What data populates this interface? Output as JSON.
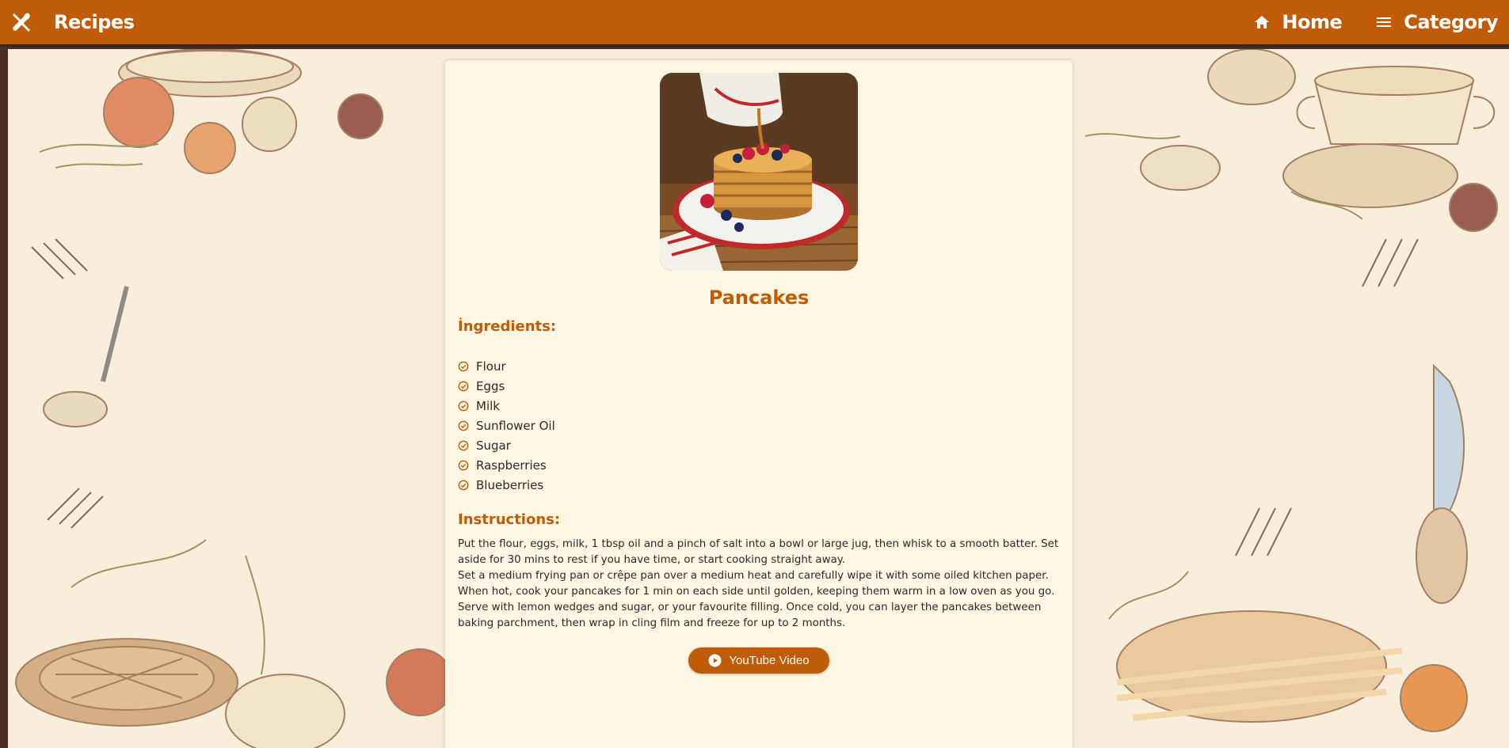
{
  "navbar": {
    "brand_icon": "fork-knife-icon",
    "brand_label": "Recipes",
    "links": [
      {
        "icon": "home-icon",
        "label": "Home"
      },
      {
        "icon": "menu-icon",
        "label": "Category"
      }
    ]
  },
  "recipe": {
    "image_alt": "pancakes-photo",
    "title": "Pancakes",
    "ingredients_heading": "İngredients:",
    "ingredients": [
      "Flour",
      "Eggs",
      "Milk",
      "Sunflower Oil",
      "Sugar",
      "Raspberries",
      "Blueberries"
    ],
    "instructions_heading": "Instructions:",
    "instructions": [
      "Put the flour, eggs, milk, 1 tbsp oil and a pinch of salt into a bowl or large jug, then whisk to a smooth batter. Set aside for 30 mins to rest if you have time, or start cooking straight away.",
      "Set a medium frying pan or crêpe pan over a medium heat and carefully wipe it with some oiled kitchen paper. When hot, cook your pancakes for 1 min on each side until golden, keeping them warm in a low oven as you go.",
      "Serve with lemon wedges and sugar, or your favourite filling. Once cold, you can layer the pancakes between baking parchment, then wrap in cling film and freeze for up to 2 months."
    ],
    "video_button_label": "YouTube Video",
    "video_icon": "play-circle-icon"
  },
  "colors": {
    "accent": "#c05c08",
    "card_background": "#fdf6e2",
    "page_background": "#f8eedb"
  }
}
